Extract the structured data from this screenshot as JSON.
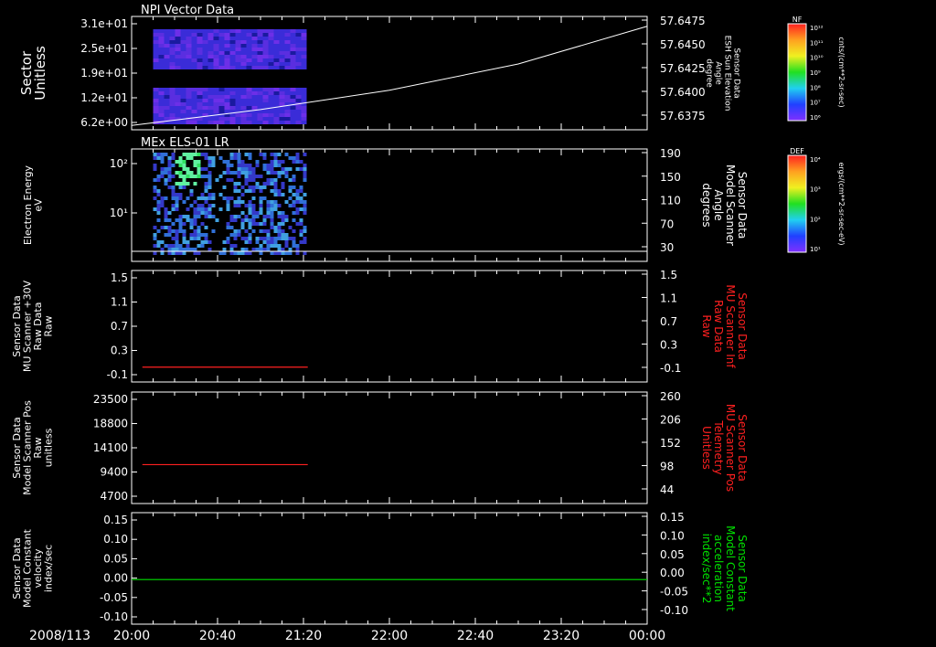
{
  "date_label": "2008/113",
  "x_ticks": [
    "20:00",
    "20:40",
    "21:20",
    "22:00",
    "22:40",
    "23:20",
    "00:00"
  ],
  "colors": {
    "background": "#000000",
    "axis": "#ffffff",
    "trace_red": "#ff2020",
    "trace_green": "#00e000",
    "label_red": "#ff2020",
    "label_green": "#00e000"
  },
  "chart_data": [
    {
      "type": "heatmap",
      "title": "NPI Vector Data",
      "ylabel": [
        "Sector",
        "Unitless"
      ],
      "yticks": [
        "3.1e+01",
        "2.5e+01",
        "1.9e+01",
        "1.2e+01",
        "6.2e+00"
      ],
      "right_label": [
        "Sensor Data",
        "ESH Sun Elevation",
        "Angle",
        "degree"
      ],
      "right_ticks": [
        "57.6475",
        "57.6450",
        "57.6425",
        "57.6400",
        "57.6375"
      ],
      "data_span": [
        "20:10",
        "21:20"
      ],
      "overlay_line": {
        "label": "ESH Sun Elevation Angle",
        "times": [
          "20:00",
          "21:00",
          "22:00",
          "23:00",
          "00:00"
        ],
        "values": [
          57.6355,
          57.6373,
          57.6395,
          57.6425,
          57.6468
        ]
      },
      "colorbar": {
        "label": "NF",
        "unit": "cnts/(cm**2-sr-sec)",
        "ticks": [
          "10¹²",
          "10¹¹",
          "10¹⁰",
          "10⁹",
          "10⁸",
          "10⁷",
          "10⁶"
        ]
      }
    },
    {
      "type": "heatmap",
      "title": "MEx ELS-01 LR",
      "ylabel": [
        "Electron Energy",
        "eV"
      ],
      "yticks": [
        "10²",
        "10¹"
      ],
      "right_label": [
        "Sensor Data",
        "Model Scanner",
        "Angle",
        "degrees"
      ],
      "right_ticks": [
        "190",
        "150",
        "110",
        "70",
        "30"
      ],
      "data_span": [
        "20:10",
        "21:20"
      ],
      "overlay_line": {
        "label": "Model Scanner Angle",
        "times": [
          "20:00",
          "00:00"
        ],
        "values": [
          10,
          10
        ]
      },
      "colorbar": {
        "label": "DEF",
        "unit": "ergs/(cm**2-sr-sec-eV)",
        "ticks": [
          "10⁴",
          "10³",
          "10²",
          "10¹"
        ]
      }
    },
    {
      "type": "line",
      "ylabel": [
        "Sensor Data",
        "MU Scanner +30V",
        "Raw Data",
        "Raw"
      ],
      "yticks": [
        "1.5",
        "1.1",
        "0.7",
        "0.3",
        "-0.1"
      ],
      "right_label": [
        "Sensor Data",
        "MU Scanner Inf",
        "Raw Data",
        "Raw"
      ],
      "right_ticks": [
        "1.5",
        "1.1",
        "0.7",
        "0.3",
        "-0.1"
      ],
      "ylim": [
        -0.3,
        1.5
      ],
      "series": [
        {
          "name": "MU Scanner Inf Raw Data",
          "times": [
            "20:05",
            "21:22"
          ],
          "values": [
            -0.06,
            -0.06
          ],
          "color": "#ff2020"
        }
      ]
    },
    {
      "type": "line",
      "ylabel": [
        "Sensor Data",
        "Model Scanner Pos",
        "Raw",
        "unitless"
      ],
      "yticks": [
        "23500",
        "18800",
        "14100",
        "9400",
        "4700"
      ],
      "right_label": [
        "Sensor Data",
        "MU Scanner Pos",
        "Telemetry",
        "Unitless"
      ],
      "right_ticks": [
        "260",
        "206",
        "152",
        "98",
        "44"
      ],
      "ylim": [
        0,
        23500
      ],
      "series": [
        {
          "name": "MU Scanner Pos Telemetry",
          "times": [
            "20:05",
            "21:22"
          ],
          "values": [
            8200,
            8200
          ],
          "color": "#ff2020"
        }
      ]
    },
    {
      "type": "line",
      "ylabel": [
        "Sensor Data",
        "Model Constant",
        "velocity",
        "index/sec"
      ],
      "yticks": [
        "0.15",
        "0.10",
        "0.05",
        "0.00",
        "-0.05",
        "-0.10"
      ],
      "right_label": [
        "Sensor Data",
        "Model Constant",
        "acceleration",
        "index/sec**2"
      ],
      "right_ticks": [
        "0.15",
        "0.10",
        "0.05",
        "0.00",
        "-0.05",
        "-0.10"
      ],
      "ylim": [
        -0.1,
        0.15
      ],
      "series": [
        {
          "name": "Model Constant acceleration",
          "times": [
            "20:00",
            "00:00"
          ],
          "values": [
            0.0,
            0.0
          ],
          "color": "#00e000"
        }
      ]
    }
  ]
}
